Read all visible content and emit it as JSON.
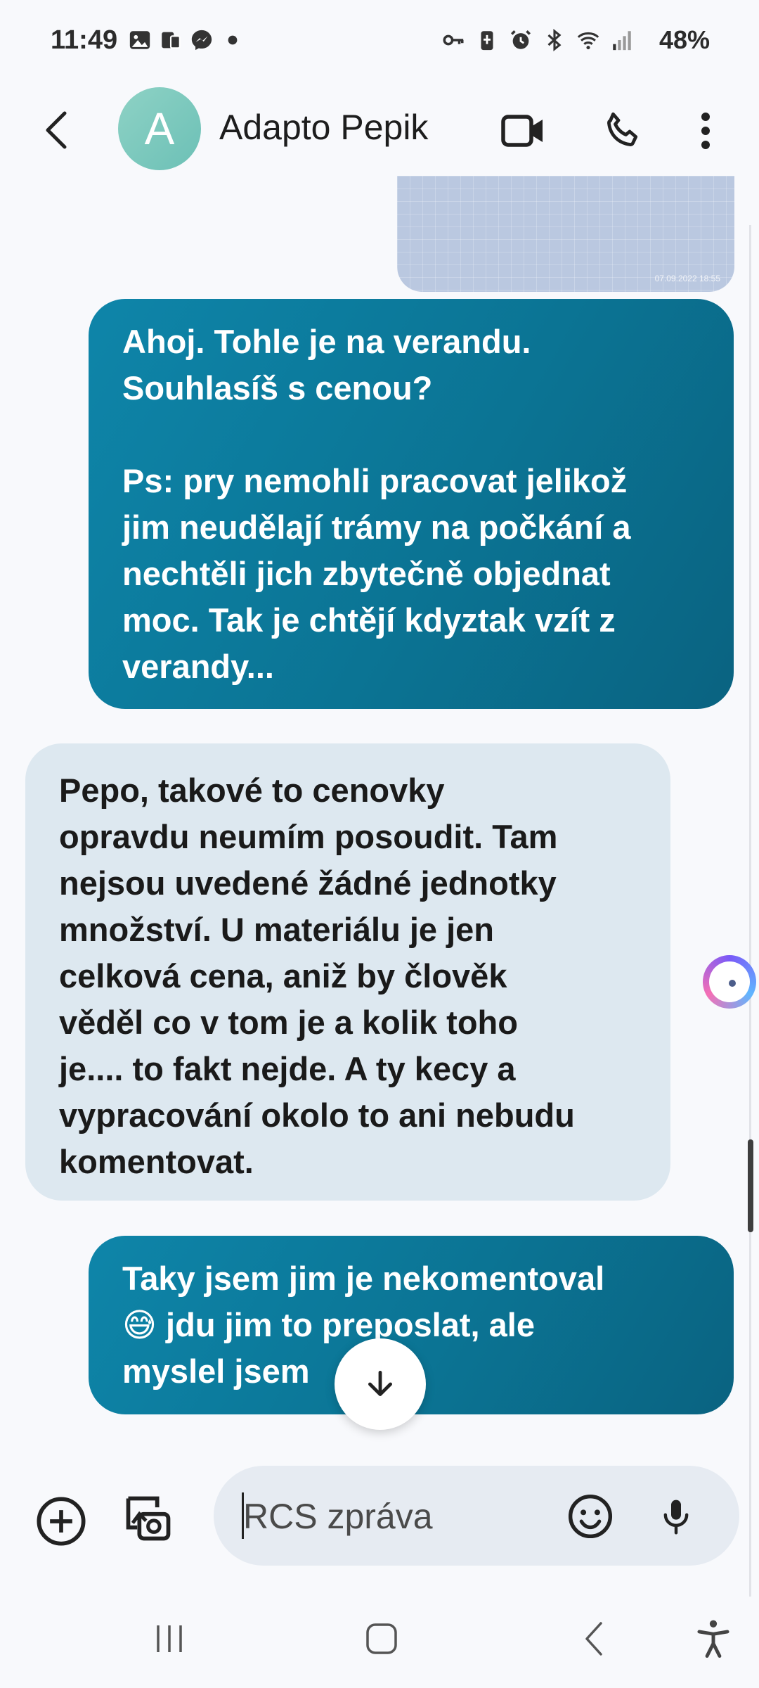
{
  "status_bar": {
    "time": "11:49",
    "battery": "48%",
    "left_icons": [
      "gallery-icon",
      "notification-icon",
      "messenger-icon",
      "dot-icon"
    ],
    "right_icons": [
      "key-icon",
      "battery-saver-icon",
      "alarm-icon",
      "bluetooth-icon",
      "wifi-icon",
      "signal-icon"
    ]
  },
  "header": {
    "avatar_letter": "A",
    "contact_name": "Adapto Pepik"
  },
  "image_message": {
    "timestamp": "07.09.2022 18:55"
  },
  "messages": [
    {
      "direction": "outgoing",
      "lines": [
        "Ahoj. Tohle je na verandu.",
        "Souhlasíš s cenou?",
        "",
        "Ps: pry nemohli pracovat jelikož",
        "jim neudělají trámy na počkání a",
        "nechtěli jich zbytečně objednat",
        "moc. Tak je chtějí kdyztak vzít z",
        "verandy..."
      ]
    },
    {
      "direction": "incoming",
      "lines": [
        "Pepo, takové to cenovky",
        "opravdu neumím posoudit. Tam",
        "nejsou uvedené žádné jednotky",
        "množství. U materiálu je jen",
        "celková cena, aniž by člověk",
        "věděl co v tom je a kolik toho",
        "je.... to fakt nejde. A ty kecy a",
        "vypracování okolo to ani nebudu",
        "komentovat."
      ]
    },
    {
      "direction": "outgoing",
      "lines": [
        "Taky jsem jim je nekomentoval",
        "😅 jdu jim to preposlat, ale",
        "myslel jsem"
      ]
    }
  ],
  "composer": {
    "placeholder": "RCS zpráva"
  },
  "colors": {
    "outgoing_bubble": "#0b7494",
    "incoming_bubble": "#dde8f0",
    "avatar": "#7ccabd",
    "background": "#f8f9fc"
  }
}
